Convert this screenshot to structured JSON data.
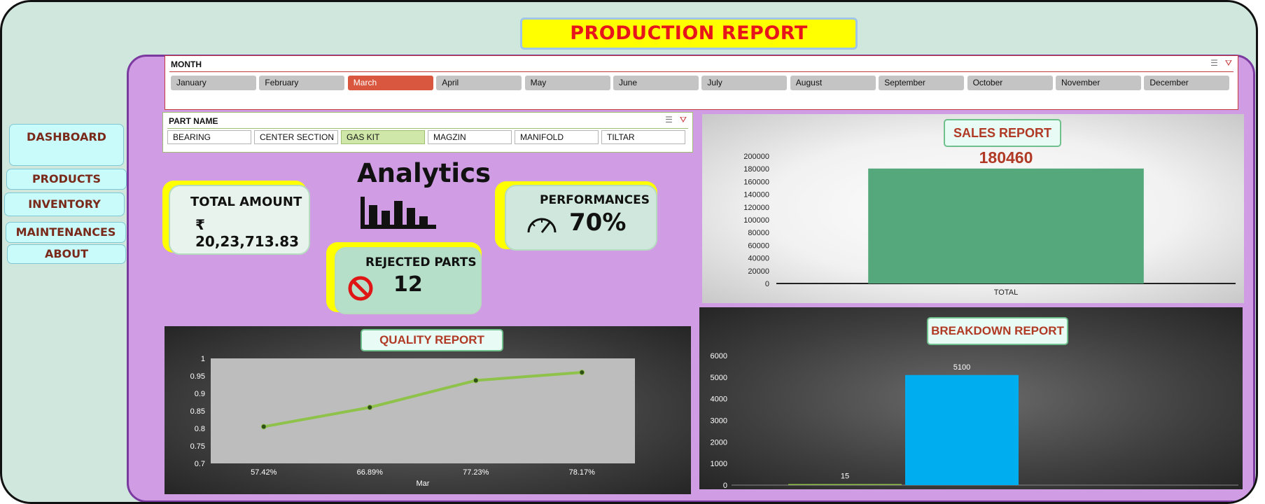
{
  "title": "PRODUCTION REPORT",
  "nav": {
    "dashboard": "DASHBOARD",
    "products": "PRODUCTS",
    "inventory": "INVENTORY",
    "maintenances": "MAINTENANCES",
    "about": "ABOUT"
  },
  "month_slicer": {
    "title": "MONTH",
    "items": [
      "January",
      "February",
      "March",
      "April",
      "May",
      "June",
      "July",
      "August",
      "September",
      "October",
      "November",
      "December"
    ],
    "selected": "March"
  },
  "part_slicer": {
    "title": "PART NAME",
    "items": [
      "BEARING",
      "CENTER SECTION",
      "GAS KIT",
      "MAGZIN",
      "MANIFOLD",
      "TILTAR"
    ],
    "selected": "GAS KIT"
  },
  "icons": {
    "multi_select": "multi-select-icon",
    "clear_filter": "clear-filter-icon",
    "analytics": "bar-chart-icon",
    "performance": "gauge-icon",
    "rejected": "prohibited-icon"
  },
  "kpis": {
    "total_amount_label": "TOTAL AMOUNT",
    "total_amount_value": "₹ 20,23,713.83",
    "analytics_label": "Analytics",
    "performance_label": "PERFORMANCES",
    "performance_value": "70%",
    "rejected_label": "REJECTED PARTS",
    "rejected_value": "12"
  },
  "colors": {
    "frame_bg": "#d0e7dd",
    "panel_purple": "#d09ce4",
    "title_yellow": "#ffff00",
    "title_red": "#e8141b",
    "month_selected": "#d9573e",
    "part_selected": "#cfe8a9",
    "sales_bar": "#55a87b",
    "breakdown_bar": "#00adef",
    "quality_line": "#8fc24a",
    "chart_title_text": "#b03a25"
  },
  "chart_data": [
    {
      "type": "bar",
      "title": "SALES REPORT",
      "categories": [
        "TOTAL"
      ],
      "values": [
        180460
      ],
      "data_labels": [
        "180460"
      ],
      "ylim": [
        0,
        200000
      ],
      "yticks": [
        0,
        20000,
        40000,
        60000,
        80000,
        100000,
        120000,
        140000,
        160000,
        180000,
        200000
      ],
      "grid": false,
      "bar_color": "#55a87b"
    },
    {
      "type": "line",
      "title": "QUALITY REPORT",
      "categories": [
        "57.42%",
        "66.89%",
        "77.23%",
        "78.17%"
      ],
      "xlabel": "Mar",
      "values": [
        0.805,
        0.86,
        0.937,
        0.96
      ],
      "ylim": [
        0.7,
        1
      ],
      "yticks": [
        "0.7",
        "0.75",
        "0.8",
        "0.85",
        "0.9",
        "0.95",
        "1"
      ],
      "line_color": "#8fc24a"
    },
    {
      "type": "bar",
      "title": "BREAKDOWN REPORT",
      "values": [
        15,
        5100
      ],
      "data_labels": [
        "15",
        "5100"
      ],
      "ylim": [
        0,
        6000
      ],
      "yticks": [
        0,
        1000,
        2000,
        3000,
        4000,
        5000,
        6000
      ],
      "bar_colors": [
        "#8fc24a",
        "#00adef"
      ]
    }
  ]
}
